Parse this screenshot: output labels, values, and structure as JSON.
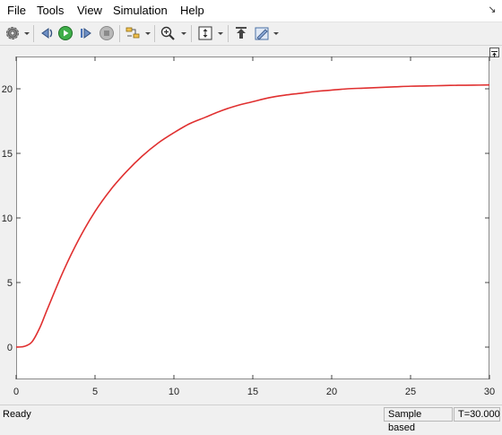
{
  "menubar": {
    "items": [
      "File",
      "Tools",
      "View",
      "Simulation",
      "Help"
    ]
  },
  "toolbar": {
    "icons": [
      "settings-gear",
      "step-back",
      "run",
      "step-forward",
      "stop",
      "highlight-model",
      "zoom-in",
      "autoscale",
      "restore-view",
      "style"
    ]
  },
  "chart_data": {
    "type": "line",
    "x_ticks": [
      0,
      5,
      10,
      15,
      20,
      25,
      30
    ],
    "y_ticks": [
      0,
      5,
      10,
      15,
      20
    ],
    "xlim": [
      0,
      30
    ],
    "ylim": [
      -2.5,
      22.5
    ],
    "grid": false,
    "series": [
      {
        "color": "#e03030",
        "x": [
          0,
          0.5,
          1,
          1.5,
          2,
          3,
          4,
          5,
          6,
          7,
          8,
          9,
          10,
          11,
          12,
          13,
          14,
          15,
          16,
          17,
          18,
          19,
          20,
          21,
          22,
          23,
          24,
          25,
          26,
          27,
          28,
          29,
          30
        ],
        "y": [
          0,
          0.05,
          0.4,
          1.5,
          3.0,
          5.9,
          8.4,
          10.5,
          12.2,
          13.6,
          14.8,
          15.8,
          16.6,
          17.3,
          17.8,
          18.3,
          18.7,
          19.0,
          19.3,
          19.5,
          19.65,
          19.8,
          19.9,
          20.0,
          20.05,
          20.1,
          20.15,
          20.2,
          20.22,
          20.25,
          20.27,
          20.28,
          20.3
        ]
      }
    ]
  },
  "status": {
    "left": "Ready",
    "mode": "Sample based",
    "time": "T=30.000"
  }
}
